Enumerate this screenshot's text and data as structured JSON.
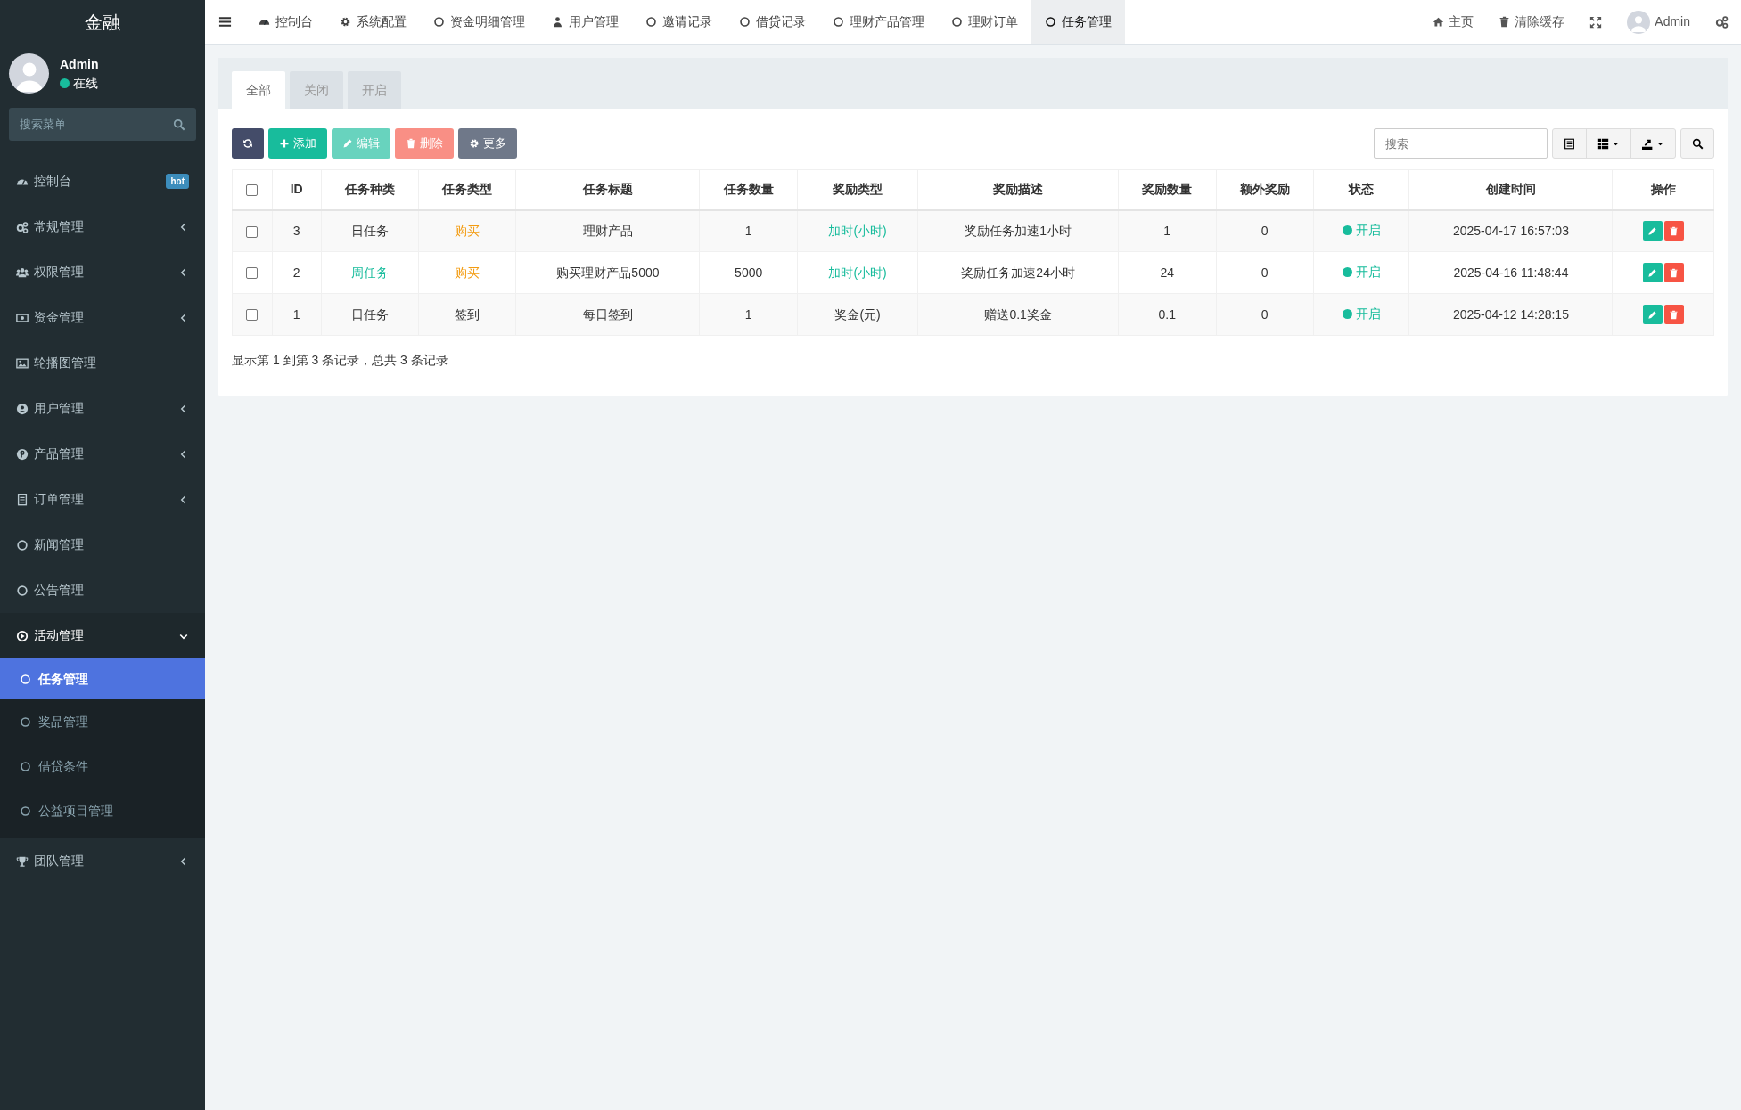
{
  "brand": "金融",
  "user": {
    "name": "Admin",
    "status": "在线"
  },
  "sidebar": {
    "search": {
      "placeholder": "搜索菜单"
    },
    "items": [
      {
        "label": "控制台",
        "badge": "hot"
      },
      {
        "label": "常规管理",
        "expanded": false
      },
      {
        "label": "权限管理",
        "expanded": false
      },
      {
        "label": "资金管理",
        "expanded": false
      },
      {
        "label": "轮播图管理"
      },
      {
        "label": "用户管理",
        "expanded": false
      },
      {
        "label": "产品管理",
        "expanded": false
      },
      {
        "label": "订单管理",
        "expanded": false
      },
      {
        "label": "新闻管理"
      },
      {
        "label": "公告管理"
      },
      {
        "label": "活动管理",
        "expanded": true,
        "children": [
          {
            "label": "任务管理",
            "selected": true
          },
          {
            "label": "奖品管理",
            "selected": false
          },
          {
            "label": "借贷条件",
            "selected": false
          },
          {
            "label": "公益项目管理",
            "selected": false
          }
        ]
      },
      {
        "label": "团队管理",
        "expanded": false
      }
    ]
  },
  "top_tabs": [
    {
      "label": "控制台",
      "selected": false
    },
    {
      "label": "系统配置",
      "selected": false
    },
    {
      "label": "资金明细管理",
      "selected": false
    },
    {
      "label": "用户管理",
      "selected": false
    },
    {
      "label": "邀请记录",
      "selected": false
    },
    {
      "label": "借贷记录",
      "selected": false
    },
    {
      "label": "理财产品管理",
      "selected": false
    },
    {
      "label": "理财订单",
      "selected": false
    },
    {
      "label": "任务管理",
      "selected": true
    }
  ],
  "top_right": {
    "home": "主页",
    "clear_cache": "清除缓存",
    "user": "Admin"
  },
  "filter_tabs": [
    {
      "label": "全部",
      "selected": true
    },
    {
      "label": "关闭",
      "selected": false
    },
    {
      "label": "开启",
      "selected": false
    }
  ],
  "toolbar": [
    {
      "kind": "refresh",
      "disabled": false
    },
    {
      "kind": "add",
      "label": "添加",
      "disabled": false
    },
    {
      "kind": "edit",
      "label": "编辑",
      "disabled": true
    },
    {
      "kind": "delete",
      "label": "删除",
      "disabled": true
    },
    {
      "kind": "more",
      "label": "更多",
      "disabled": false
    }
  ],
  "search": {
    "placeholder": "搜索"
  },
  "table": {
    "header_checked": false,
    "columns": [
      "ID",
      "任务种类",
      "任务类型",
      "任务标题",
      "任务数量",
      "奖励类型",
      "奖励描述",
      "奖励数量",
      "额外奖励",
      "状态",
      "创建时间",
      "操作"
    ],
    "rows": [
      {
        "checked": false,
        "cells": [
          {
            "text": "3"
          },
          {
            "text": "日任务"
          },
          {
            "text": "购买",
            "color": "#f39c12"
          },
          {
            "text": "理财产品"
          },
          {
            "text": "1"
          },
          {
            "text": "加时(小时)",
            "color": "#18bc9c"
          },
          {
            "text": "奖励任务加速1小时"
          },
          {
            "text": "1"
          },
          {
            "text": "0"
          }
        ],
        "status": {
          "text": "开启",
          "on": true
        },
        "created": "2025-04-17 16:57:03"
      },
      {
        "checked": false,
        "cells": [
          {
            "text": "2"
          },
          {
            "text": "周任务",
            "color": "#18bc9c"
          },
          {
            "text": "购买",
            "color": "#f39c12"
          },
          {
            "text": "购买理财产品5000"
          },
          {
            "text": "5000"
          },
          {
            "text": "加时(小时)",
            "color": "#18bc9c"
          },
          {
            "text": "奖励任务加速24小时"
          },
          {
            "text": "24"
          },
          {
            "text": "0"
          }
        ],
        "status": {
          "text": "开启",
          "on": true
        },
        "created": "2025-04-16 11:48:44"
      },
      {
        "checked": false,
        "cells": [
          {
            "text": "1"
          },
          {
            "text": "日任务"
          },
          {
            "text": "签到"
          },
          {
            "text": "每日签到"
          },
          {
            "text": "1"
          },
          {
            "text": "奖金(元)"
          },
          {
            "text": "赠送0.1奖金"
          },
          {
            "text": "0.1"
          },
          {
            "text": "0"
          }
        ],
        "status": {
          "text": "开启",
          "on": true
        },
        "created": "2025-04-12 14:28:15"
      }
    ]
  },
  "pagination_info": "显示第 1 到第 3 条记录，总共 3 条记录"
}
